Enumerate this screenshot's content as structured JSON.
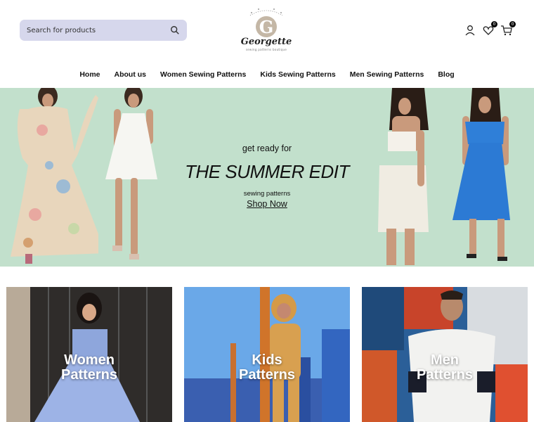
{
  "search": {
    "placeholder": "Search for products",
    "icon": "search-icon"
  },
  "logo": {
    "brand": "Georgette",
    "tagline": "sewing patterns boutique"
  },
  "header_icons": [
    {
      "name": "account-icon"
    },
    {
      "name": "wishlist-icon",
      "badge": "0"
    },
    {
      "name": "cart-icon",
      "badge": "0"
    }
  ],
  "nav": {
    "items": [
      "Home",
      "About us",
      "Women Sewing Patterns",
      "Kids Sewing Patterns",
      "Men Sewing Patterns",
      "Blog"
    ]
  },
  "hero": {
    "pre_title": "get ready for",
    "title": "THE SUMMER EDIT",
    "subtitle": "sewing patterns",
    "cta": "Shop Now",
    "background": "#c2e0cc"
  },
  "categories": [
    {
      "label": "Women Patterns"
    },
    {
      "label": "Kids Patterns"
    },
    {
      "label": "Men Patterns"
    }
  ]
}
